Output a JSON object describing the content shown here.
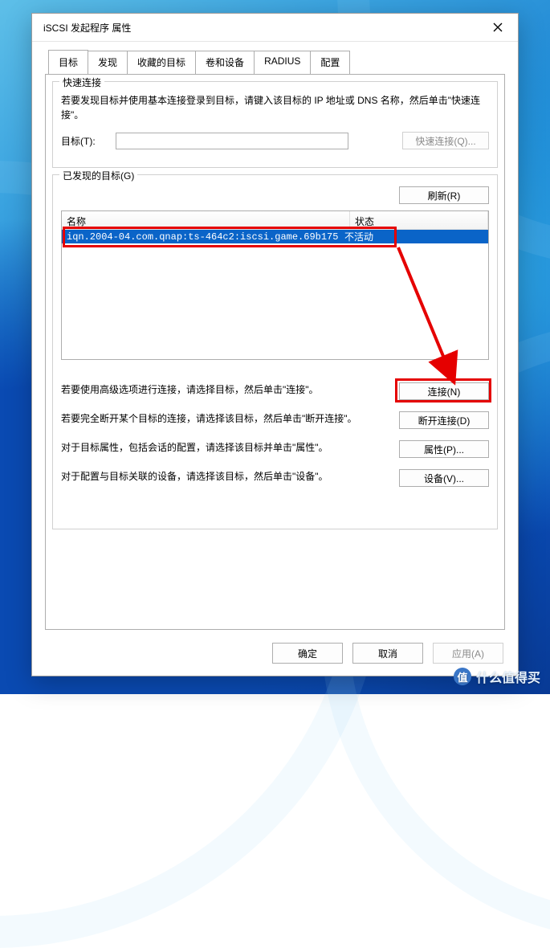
{
  "window": {
    "title": "iSCSI 发起程序 属性"
  },
  "tabs": [
    {
      "label": "目标",
      "active": true
    },
    {
      "label": "发现",
      "active": false
    },
    {
      "label": "收藏的目标",
      "active": false
    },
    {
      "label": "卷和设备",
      "active": false
    },
    {
      "label": "RADIUS",
      "active": false
    },
    {
      "label": "配置",
      "active": false
    }
  ],
  "quick_connect": {
    "legend": "快速连接",
    "description": "若要发现目标并使用基本连接登录到目标，请键入该目标的 IP 地址或 DNS 名称，然后单击\"快速连接\"。",
    "target_label": "目标(T):",
    "target_value": "",
    "button_label": "快速连接(Q)..."
  },
  "discovered": {
    "legend": "已发现的目标(G)",
    "refresh_label": "刷新(R)",
    "columns": {
      "name": "名称",
      "status": "状态"
    },
    "rows": [
      {
        "name": "iqn.2004-04.com.qnap:ts-464c2:iscsi.game.69b175",
        "status": "不活动",
        "selected": true
      }
    ],
    "hints": {
      "connect_text": "若要使用高级选项进行连接，请选择目标，然后单击\"连接\"。",
      "connect_btn": "连接(N)",
      "disconnect_text": "若要完全断开某个目标的连接，请选择该目标，然后单击\"断开连接\"。",
      "disconnect_btn": "断开连接(D)",
      "properties_text": "对于目标属性，包括会话的配置，请选择该目标并单击\"属性\"。",
      "properties_btn": "属性(P)...",
      "devices_text": "对于配置与目标关联的设备，请选择该目标，然后单击\"设备\"。",
      "devices_btn": "设备(V)..."
    }
  },
  "footer": {
    "ok": "确定",
    "cancel": "取消",
    "apply": "应用(A)"
  },
  "watermark": "什么值得买"
}
